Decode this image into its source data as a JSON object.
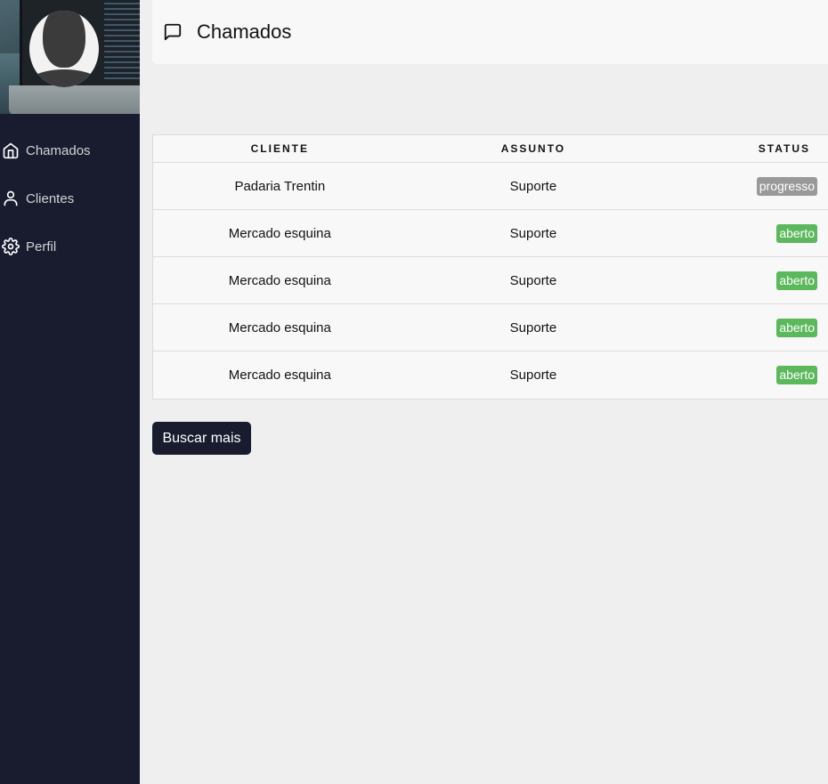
{
  "sidebar": {
    "items": [
      {
        "label": "Chamados",
        "icon": "home-icon"
      },
      {
        "label": "Clientes",
        "icon": "user-icon"
      },
      {
        "label": "Perfil",
        "icon": "gear-icon"
      }
    ]
  },
  "header": {
    "title": "Chamados",
    "icon": "message-square-icon"
  },
  "table": {
    "columns": [
      "CLIENTE",
      "ASSUNTO",
      "STATUS"
    ],
    "rows": [
      {
        "cliente": "Padaria Trentin",
        "assunto": "Suporte",
        "status": "progresso",
        "status_color": "#999999"
      },
      {
        "cliente": "Mercado esquina",
        "assunto": "Suporte",
        "status": "aberto",
        "status_color": "#5cb85c"
      },
      {
        "cliente": "Mercado esquina",
        "assunto": "Suporte",
        "status": "aberto",
        "status_color": "#5cb85c"
      },
      {
        "cliente": "Mercado esquina",
        "assunto": "Suporte",
        "status": "aberto",
        "status_color": "#5cb85c"
      },
      {
        "cliente": "Mercado esquina",
        "assunto": "Suporte",
        "status": "aberto",
        "status_color": "#5cb85c"
      }
    ]
  },
  "actions": {
    "load_more_label": "Buscar mais"
  },
  "colors": {
    "sidebar_bg": "#181c2e",
    "page_bg": "#efefef",
    "status_progress": "#999999",
    "status_open": "#5cb85c"
  }
}
